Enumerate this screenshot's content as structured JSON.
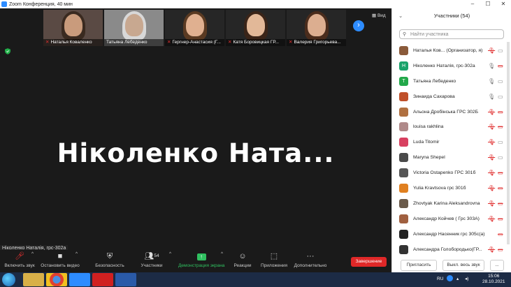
{
  "window": {
    "title": "Zoom Конференция, 40 мин"
  },
  "strip": {
    "thumbs": [
      {
        "name": "Наталья Коваленко",
        "muted": true
      },
      {
        "name": "Татьяна Лебеденко",
        "muted": false
      },
      {
        "name": "Гергнер-Анастасия (Г...",
        "muted": true
      },
      {
        "name": "Катя Боровицкая ГР...",
        "muted": true
      },
      {
        "name": "Валерия Григорьева...",
        "muted": true
      }
    ],
    "view_label": "Вид"
  },
  "main": {
    "big_name": "Ніколенко  Ната...",
    "name_label": "Ніколенко Наталія, грс-302а"
  },
  "toolbar": {
    "unmute": "Включить звук",
    "stop_video": "Остановить видео",
    "security": "Безопасность",
    "participants": "Участники",
    "participants_count": "54",
    "share": "Демонстрация экрана",
    "reactions": "Реакции",
    "apps": "Приложения",
    "more": "Дополнительно",
    "end": "Завершение"
  },
  "panel": {
    "title": "Участники (54)",
    "search_placeholder": "Найти участника",
    "invite": "Пригласить",
    "mute_all": "Выкл. весь звук",
    "more": "...",
    "participants": [
      {
        "name": "Наталья Ков...  (Организатор, я)",
        "avatar": "",
        "color": "#8a5a3a",
        "mic": "off",
        "cam": "on"
      },
      {
        "name": "Ніколенко Наталія, грс-302а",
        "avatar": "Н",
        "color": "#1aa36b",
        "mic": "on",
        "cam": "off"
      },
      {
        "name": "Татьяна Лебеденко",
        "avatar": "Т",
        "color": "#22a84a",
        "mic": "on",
        "cam": "on"
      },
      {
        "name": "Зинаида Сахарова",
        "avatar": "",
        "color": "#c0502a",
        "mic": "on",
        "cam": "on"
      },
      {
        "name": "Альона Дробінська ГРС 302Б",
        "avatar": "",
        "color": "#b07040",
        "mic": "off",
        "cam": "off"
      },
      {
        "name": "louisa rakhlina",
        "avatar": "",
        "color": "#b08a8a",
        "mic": "off",
        "cam": "off"
      },
      {
        "name": "Luda Titomir",
        "avatar": "",
        "color": "#d84060",
        "mic": "off",
        "cam": "on"
      },
      {
        "name": "Maryna Shepel",
        "avatar": "",
        "color": "#4a4a4a",
        "mic": "off",
        "cam": "on"
      },
      {
        "name": "Victoria Ostapenko  ГРС 301б",
        "avatar": "",
        "color": "#555555",
        "mic": "off",
        "cam": "off"
      },
      {
        "name": "Yulia Kravtsova грс 301б",
        "avatar": "",
        "color": "#e08020",
        "mic": "off",
        "cam": "off"
      },
      {
        "name": "Zhovtyak Karina Aleksandrovna",
        "avatar": "",
        "color": "#6a5a4a",
        "mic": "off",
        "cam": "off"
      },
      {
        "name": "Александр Койчев ( Грс 303А)",
        "avatar": "",
        "color": "#a06040",
        "mic": "off",
        "cam": "off"
      },
      {
        "name": "Александр Насенник грс 305с(а)",
        "avatar": "",
        "color": "#222222",
        "mic": "",
        "cam": "off"
      },
      {
        "name": "Александра Голобородько(ГР...",
        "avatar": "",
        "color": "#333333",
        "mic": "off",
        "cam": "off"
      }
    ]
  },
  "taskbar": {
    "lang": "RU",
    "time": "15:06",
    "date": "28.10.2021"
  }
}
